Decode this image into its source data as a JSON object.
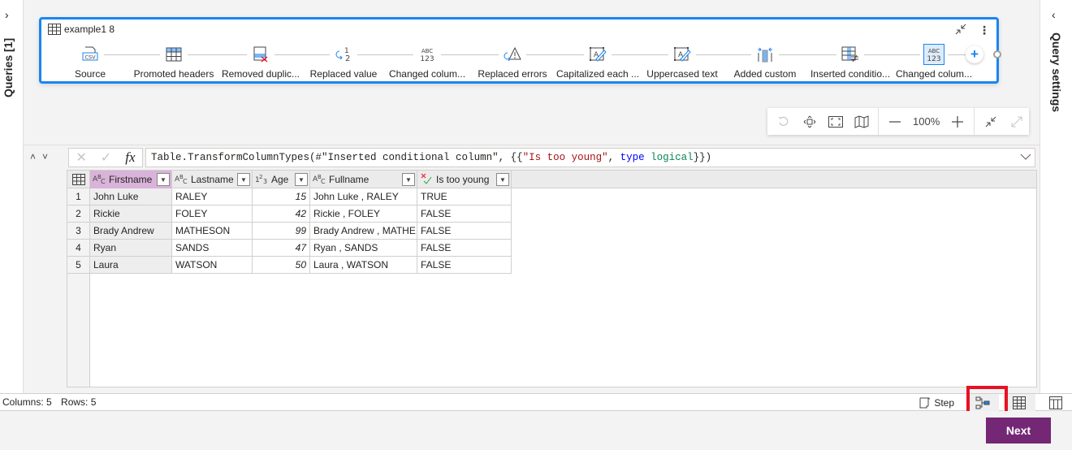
{
  "left_rail": {
    "label": "Queries [1]",
    "chevron": "chevron-right-icon"
  },
  "right_rail": {
    "label": "Query settings",
    "chevron": "chevron-left-icon"
  },
  "query_card": {
    "title": "example1 8",
    "steps": [
      {
        "label": "Source",
        "icon": "csv-file-icon"
      },
      {
        "label": "Promoted headers",
        "icon": "table-header-icon"
      },
      {
        "label": "Removed duplic...",
        "icon": "remove-duplicates-icon"
      },
      {
        "label": "Replaced value",
        "icon": "replace-value-icon"
      },
      {
        "label": "Changed colum...",
        "icon": "abc-123-icon"
      },
      {
        "label": "Replaced errors",
        "icon": "replace-errors-icon"
      },
      {
        "label": "Capitalized each ...",
        "icon": "text-edit-icon"
      },
      {
        "label": "Uppercased text",
        "icon": "text-edit-icon"
      },
      {
        "label": "Added custom",
        "icon": "add-custom-column-icon"
      },
      {
        "label": "Inserted conditio...",
        "icon": "conditional-column-icon"
      },
      {
        "label": "Changed colum...",
        "icon": "abc-123-icon",
        "selected": true
      }
    ]
  },
  "zoom_toolbar": {
    "zoom_level": "100%"
  },
  "formula_bar": {
    "prefix": "Table.TransformColumnTypes(#\"Inserted conditional column\", {{",
    "string": "\"Is too young\"",
    "sep": ", ",
    "keyword": "type",
    "space": " ",
    "type": "logical",
    "suffix": "}})"
  },
  "table": {
    "columns": [
      {
        "name": "Firstname",
        "type": "ABC",
        "selected": true
      },
      {
        "name": "Lastname",
        "type": "ABC"
      },
      {
        "name": "Age",
        "type": "123"
      },
      {
        "name": "Fullname",
        "type": "ABC"
      },
      {
        "name": "Is too young",
        "type": "logical"
      }
    ],
    "rows": [
      [
        "1",
        "John Luke",
        "RALEY",
        "15",
        "John Luke , RALEY",
        "TRUE"
      ],
      [
        "2",
        "Rickie",
        "FOLEY",
        "42",
        "Rickie , FOLEY",
        "FALSE"
      ],
      [
        "3",
        "Brady Andrew",
        "MATHESON",
        "99",
        "Brady Andrew , MATHE...",
        "FALSE"
      ],
      [
        "4",
        "Ryan",
        "SANDS",
        "47",
        "Ryan , SANDS",
        "FALSE"
      ],
      [
        "5",
        "Laura",
        "WATSON",
        "50",
        "Laura , WATSON",
        "FALSE"
      ]
    ]
  },
  "status": {
    "columns": "Columns: 5",
    "rows": "Rows: 5",
    "step_label": "Step"
  },
  "footer": {
    "next_label": "Next"
  },
  "colors": {
    "accent": "#1a86f0",
    "next": "#742774",
    "selected_column": "#d9b3d9",
    "highlight": "#e81123"
  }
}
